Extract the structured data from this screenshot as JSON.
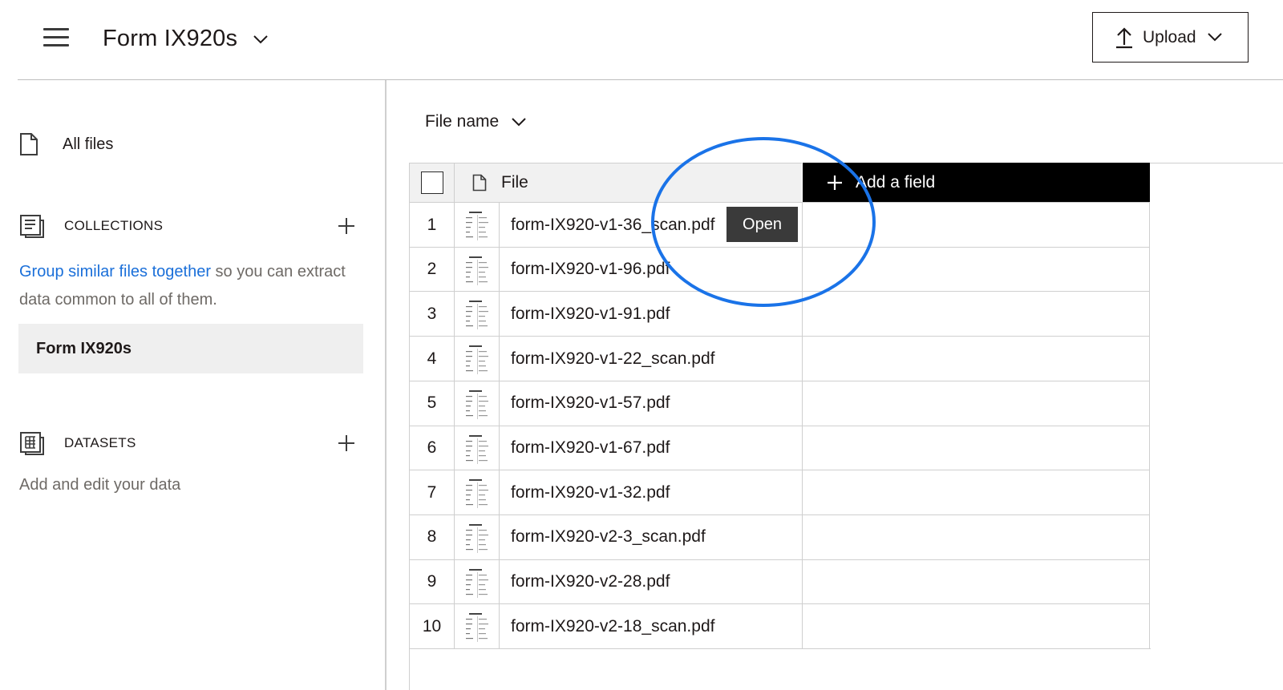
{
  "header": {
    "title": "Form IX920s",
    "upload_label": "Upload"
  },
  "sidebar": {
    "all_files_label": "All files",
    "collections": {
      "heading": "COLLECTIONS",
      "link_text": "Group similar files together",
      "desc_text": " so you can extract data common to all of them.",
      "items": [
        "Form IX920s"
      ]
    },
    "datasets": {
      "heading": "DATASETS",
      "desc": "Add and edit your data"
    }
  },
  "main": {
    "sort_label": "File name",
    "table": {
      "file_header": "File",
      "add_field_label": "Add a field",
      "open_tooltip": "Open",
      "rows": [
        {
          "num": "1",
          "file": "form-IX920-v1-36_scan.pdf"
        },
        {
          "num": "2",
          "file": "form-IX920-v1-96.pdf"
        },
        {
          "num": "3",
          "file": "form-IX920-v1-91.pdf"
        },
        {
          "num": "4",
          "file": "form-IX920-v1-22_scan.pdf"
        },
        {
          "num": "5",
          "file": "form-IX920-v1-57.pdf"
        },
        {
          "num": "6",
          "file": "form-IX920-v1-67.pdf"
        },
        {
          "num": "7",
          "file": "form-IX920-v1-32.pdf"
        },
        {
          "num": "8",
          "file": "form-IX920-v2-3_scan.pdf"
        },
        {
          "num": "9",
          "file": "form-IX920-v2-28.pdf"
        },
        {
          "num": "10",
          "file": "form-IX920-v2-18_scan.pdf"
        }
      ]
    }
  },
  "colors": {
    "link": "#1a6fd9",
    "annotation_circle": "#1a73e8",
    "add_field_bg": "#000000",
    "tooltip_bg": "#3a3a3a"
  }
}
